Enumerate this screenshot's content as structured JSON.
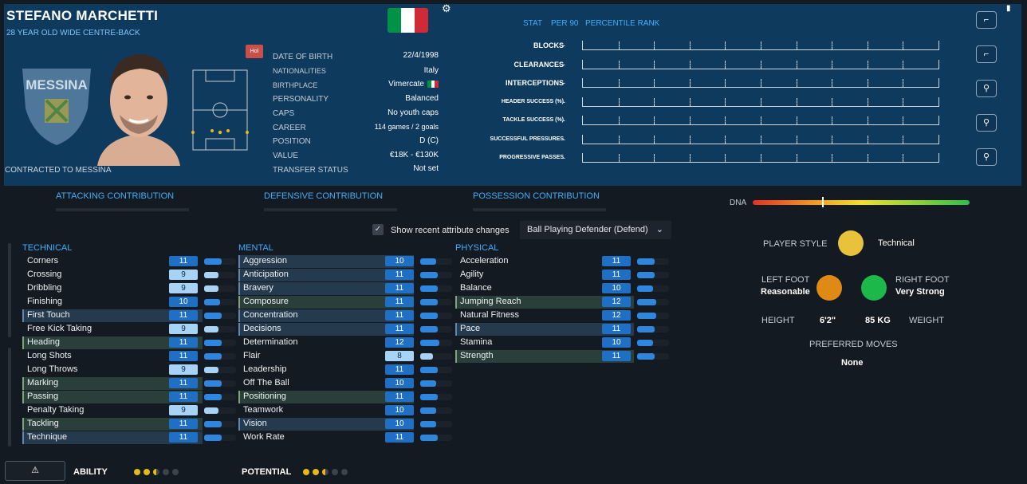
{
  "player": {
    "name": "STEFANO MARCHETTI",
    "subtitle": "28 YEAR OLD  WIDE CENTRE-BACK",
    "contracted": "CONTRACTED TO MESSINA",
    "hol_badge": "Hol",
    "club_name": "MESSINA"
  },
  "info": [
    {
      "label": "DATE OF BIRTH",
      "value": "22/4/1998"
    },
    {
      "label": "NATIONALITIES",
      "value": "Italy"
    },
    {
      "label": "BIRTHPLACE",
      "value": "Vimercate"
    },
    {
      "label": "PERSONALITY",
      "value": "Balanced"
    },
    {
      "label": "CAPS",
      "value": "No youth caps"
    },
    {
      "label": "CAREER",
      "value": "114 games /    2  goals"
    },
    {
      "label": "POSITION",
      "value": "D (C)"
    },
    {
      "label": "VALUE",
      "value": "€18K - €130K"
    },
    {
      "label": "TRANSFER STATUS",
      "value": "Not set"
    }
  ],
  "flag_colors": [
    "#009246",
    "#ffffff",
    "#ce2b37"
  ],
  "stats": {
    "headers": [
      "STAT",
      "PER 90",
      "PERCENTILE RANK"
    ],
    "rows": [
      {
        "label": "BLOCKS",
        "per90": "-"
      },
      {
        "label": "CLEARANCES",
        "per90": "-"
      },
      {
        "label": "INTERCEPTIONS",
        "per90": "-"
      },
      {
        "label": "HEADER SUCCESS (%)",
        "per90": "-"
      },
      {
        "label": "TACKLE SUCCESS (%)",
        "per90": "-"
      },
      {
        "label": "SUCCESSFUL PRESSURES",
        "per90": "-"
      },
      {
        "label": "PROGRESSIVE PASSES",
        "per90": "-"
      }
    ]
  },
  "contributions": [
    "ATTACKING CONTRIBUTION",
    "DEFENSIVE CONTRIBUTION",
    "POSSESSION CONTRIBUTION"
  ],
  "dna": {
    "label": "DNA",
    "position": 0.32
  },
  "controls": {
    "show_changes_label": "Show recent attribute changes",
    "role_select": "Ball Playing Defender (Defend)"
  },
  "attributes": {
    "technical": {
      "title": "TECHNICAL",
      "items": [
        {
          "name": "Corners",
          "value": "11",
          "hl": ""
        },
        {
          "name": "Crossing",
          "value": "9",
          "hl": ""
        },
        {
          "name": "Dribbling",
          "value": "9",
          "hl": ""
        },
        {
          "name": "Finishing",
          "value": "10",
          "hl": ""
        },
        {
          "name": "First Touch",
          "value": "11",
          "hl": "hl"
        },
        {
          "name": "Free Kick Taking",
          "value": "9",
          "hl": ""
        },
        {
          "name": "Heading",
          "value": "11",
          "hl": "hl-green"
        },
        {
          "name": "Long Shots",
          "value": "11",
          "hl": ""
        },
        {
          "name": "Long Throws",
          "value": "9",
          "hl": ""
        },
        {
          "name": "Marking",
          "value": "11",
          "hl": "hl-green"
        },
        {
          "name": "Passing",
          "value": "11",
          "hl": "hl-green"
        },
        {
          "name": "Penalty Taking",
          "value": "9",
          "hl": ""
        },
        {
          "name": "Tackling",
          "value": "11",
          "hl": "hl-green"
        },
        {
          "name": "Technique",
          "value": "11",
          "hl": "hl"
        }
      ]
    },
    "mental": {
      "title": "MENTAL",
      "items": [
        {
          "name": "Aggression",
          "value": "10",
          "hl": "hl"
        },
        {
          "name": "Anticipation",
          "value": "11",
          "hl": "hl"
        },
        {
          "name": "Bravery",
          "value": "11",
          "hl": "hl"
        },
        {
          "name": "Composure",
          "value": "11",
          "hl": "hl-green"
        },
        {
          "name": "Concentration",
          "value": "11",
          "hl": "hl"
        },
        {
          "name": "Decisions",
          "value": "11",
          "hl": "hl"
        },
        {
          "name": "Determination",
          "value": "12",
          "hl": ""
        },
        {
          "name": "Flair",
          "value": "8",
          "hl": ""
        },
        {
          "name": "Leadership",
          "value": "11",
          "hl": ""
        },
        {
          "name": "Off The Ball",
          "value": "10",
          "hl": ""
        },
        {
          "name": "Positioning",
          "value": "11",
          "hl": "hl-green"
        },
        {
          "name": "Teamwork",
          "value": "10",
          "hl": ""
        },
        {
          "name": "Vision",
          "value": "10",
          "hl": "hl"
        },
        {
          "name": "Work Rate",
          "value": "11",
          "hl": ""
        }
      ]
    },
    "physical": {
      "title": "PHYSICAL",
      "items": [
        {
          "name": "Acceleration",
          "value": "11",
          "hl": ""
        },
        {
          "name": "Agility",
          "value": "11",
          "hl": ""
        },
        {
          "name": "Balance",
          "value": "10",
          "hl": ""
        },
        {
          "name": "Jumping Reach",
          "value": "12",
          "hl": "hl-green"
        },
        {
          "name": "Natural Fitness",
          "value": "12",
          "hl": ""
        },
        {
          "name": "Pace",
          "value": "11",
          "hl": "hl"
        },
        {
          "name": "Stamina",
          "value": "10",
          "hl": ""
        },
        {
          "name": "Strength",
          "value": "11",
          "hl": "hl-green"
        }
      ]
    }
  },
  "style": {
    "player_style_label": "PLAYER STYLE",
    "player_style_value": "Technical",
    "left_foot_label": "LEFT FOOT",
    "left_foot_value": "Reasonable",
    "right_foot_label": "RIGHT FOOT",
    "right_foot_value": "Very Strong",
    "height_label": "HEIGHT",
    "height_value": "6'2\"",
    "weight_value": "85 KG",
    "weight_label": "WEIGHT",
    "preferred_moves_label": "PREFERRED MOVES",
    "preferred_moves_value": "None",
    "colors": {
      "style": "#e8c23a",
      "left_foot": "#e08a16",
      "right_foot": "#1cb84a"
    }
  },
  "footer": {
    "ability_label": "ABILITY",
    "potential_label": "POTENTIAL",
    "ability_stars": 2.5,
    "potential_stars": 2.5
  }
}
